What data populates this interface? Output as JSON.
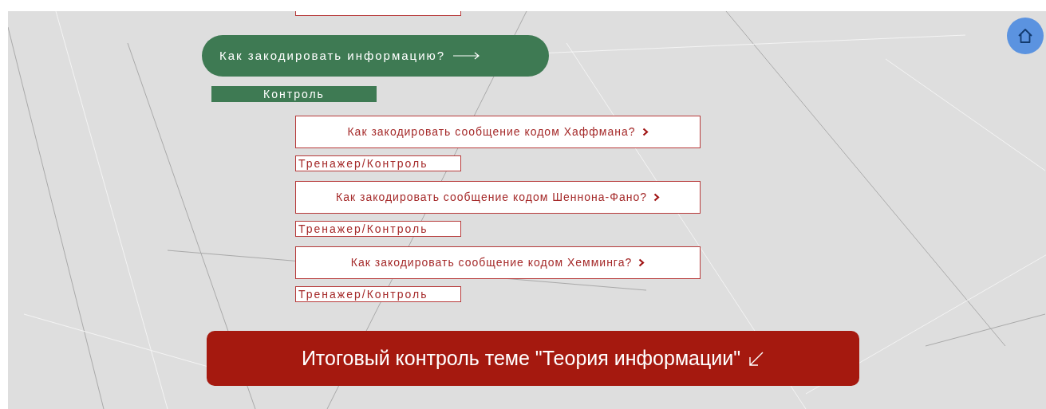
{
  "main_link": {
    "text": "Как закодировать информацию?"
  },
  "control_link": {
    "text": "Контроль"
  },
  "topics": [
    {
      "title": "Как закодировать сообщение кодом Хаффмана?",
      "trainer": "Тренажер/Контроль"
    },
    {
      "title": "Как закодировать сообщение кодом Шеннона-Фано?",
      "trainer": "Тренажер/Контроль"
    },
    {
      "title": "Как закодировать сообщение кодом Хемминга?",
      "trainer": "Тренажер/Контроль"
    }
  ],
  "final_test": {
    "text": "Итоговый контроль теме \"Теория информации\""
  }
}
